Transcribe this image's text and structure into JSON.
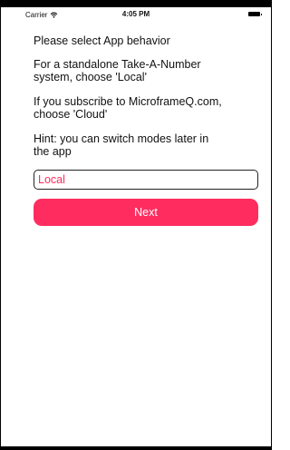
{
  "status_bar": {
    "carrier": "Carrier",
    "time": "4:05 PM",
    "wifi_icon": "wifi-icon",
    "battery_icon": "battery-icon"
  },
  "prompt": {
    "title": "Please select App behavior",
    "local_hint": "For a standalone Take-A-Number\nsystem, choose 'Local'",
    "cloud_hint": "If you subscribe to MicroframeQ.com,\nchoose 'Cloud'",
    "switch_hint": "Hint: you can switch modes later in\nthe app"
  },
  "mode_field": {
    "value": "Local"
  },
  "next_button": {
    "label": "Next"
  },
  "colors": {
    "accent": "#ff2d5f",
    "text": "#111111",
    "background": "#ffffff"
  }
}
